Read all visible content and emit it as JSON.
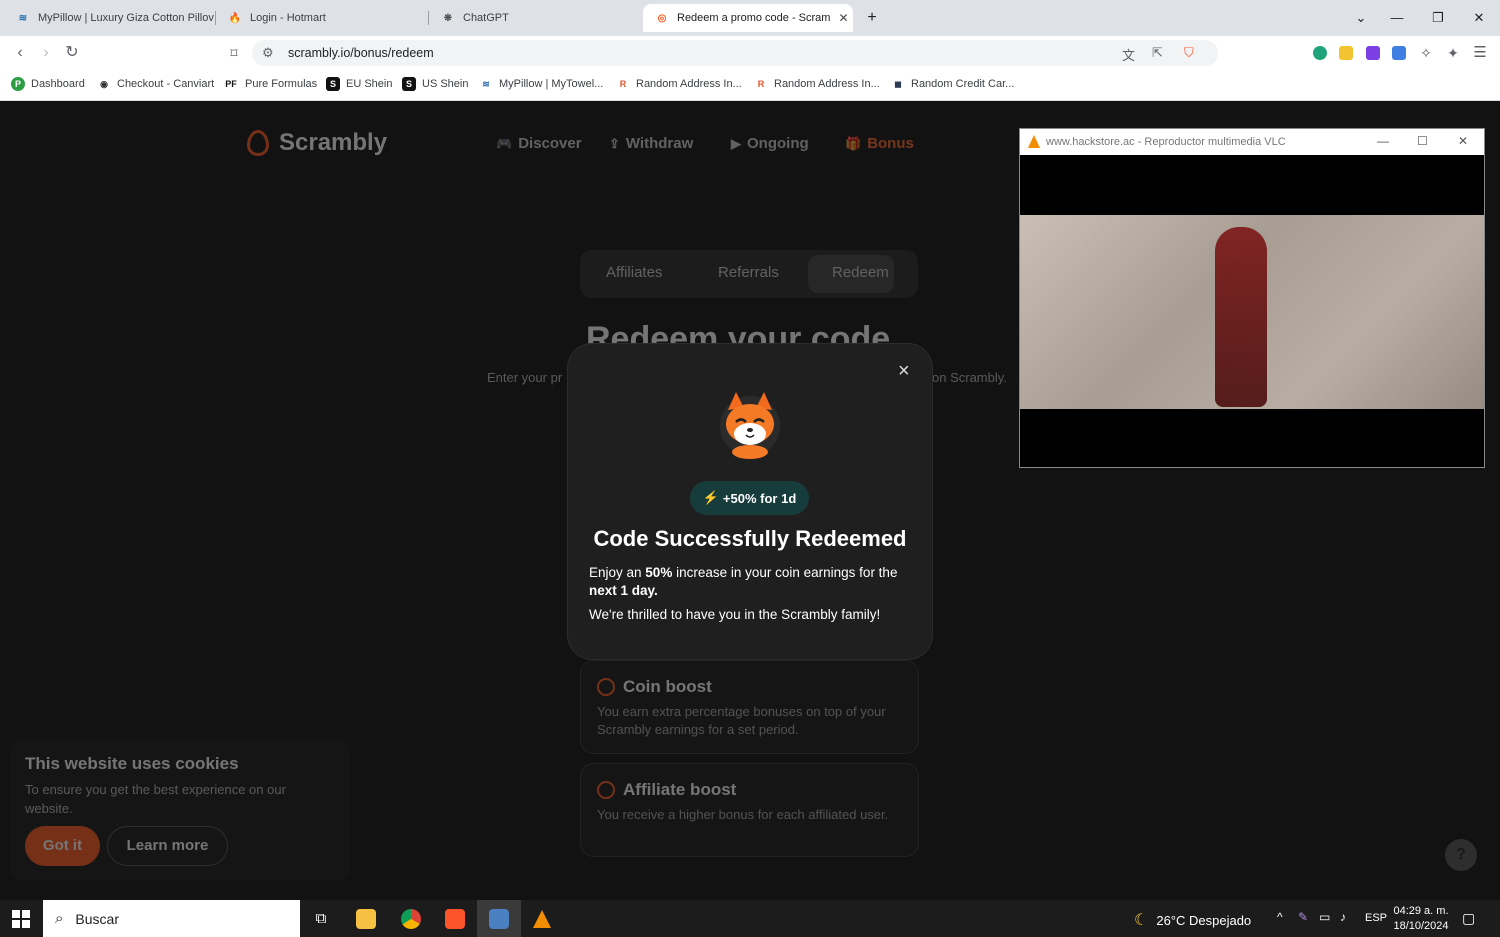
{
  "browser": {
    "tabs": [
      {
        "title": "MyPillow | Luxury Giza Cotton Pillov",
        "icon": "mypillow-icon"
      },
      {
        "title": "Login - Hotmart",
        "icon": "hotmart-icon"
      },
      {
        "title": "ChatGPT",
        "icon": "chatgpt-icon"
      },
      {
        "title": "Redeem a promo code - Scram",
        "icon": "scrambly-icon",
        "active": true
      }
    ],
    "new_tab": "+",
    "url": "scrambly.io/bonus/redeem",
    "bookmarks": [
      {
        "label": "Dashboard",
        "icon": "P",
        "color": "#2e9e44"
      },
      {
        "label": "Checkout - Canviart",
        "icon": "◉",
        "color": "#333333"
      },
      {
        "label": "Pure Formulas",
        "icon": "PF",
        "color": "#111111"
      },
      {
        "label": "EU Shein",
        "icon": "S",
        "color": "#111111"
      },
      {
        "label": "US Shein",
        "icon": "S",
        "color": "#111111"
      },
      {
        "label": "MyPillow | MyTowel...",
        "icon": "M",
        "color": "#2a6fb0"
      },
      {
        "label": "Random Address In...",
        "icon": "R",
        "color": "#e0552b"
      },
      {
        "label": "Random Address In...",
        "icon": "R",
        "color": "#e0552b"
      },
      {
        "label": "Random Credit Car...",
        "icon": "◼",
        "color": "#2b3a55"
      }
    ]
  },
  "site": {
    "brand": "Scrambly",
    "nav": [
      {
        "label": "Discover",
        "icon": "🎮"
      },
      {
        "label": "Withdraw",
        "icon": "⇪"
      },
      {
        "label": "Ongoing",
        "icon": "▶"
      },
      {
        "label": "Bonus",
        "icon": "🎁"
      }
    ],
    "segments": [
      "Affiliates",
      "Referrals",
      "Redeem"
    ],
    "heading": "Redeem your code",
    "subtext_left": "Enter your pr",
    "subtext_right": "on Scrambly.",
    "boosts": [
      {
        "title": "Coin boost",
        "desc": "You earn extra percentage bonuses on top of your Scrambly earnings for a set period."
      },
      {
        "title": "Affiliate boost",
        "desc": "You receive a higher bonus for each affiliated user."
      }
    ],
    "cookie": {
      "title": "This website uses cookies",
      "text": "To ensure you get the best experience on our website.",
      "accept": "Got it",
      "learn": "Learn more"
    },
    "help": "?",
    "accent_color": "#ff5a1f"
  },
  "modal": {
    "close": "×",
    "pill": "+50% for 1d",
    "title": "Code Successfully Redeemed",
    "body_1": "Enjoy an ",
    "body_bold_1": "50%",
    "body_2": " increase in your coin earnings for the ",
    "body_bold_2": "next 1 day.",
    "footer": "We're thrilled to have you in the Scrambly family!"
  },
  "vlc": {
    "title": "www.hackstore.ac - Reproductor multimedia VLC"
  },
  "taskbar": {
    "search_placeholder": "Buscar",
    "weather": "26°C  Despejado",
    "lang": "ESP",
    "time": "04:29 a. m.",
    "date": "18/10/2024"
  }
}
